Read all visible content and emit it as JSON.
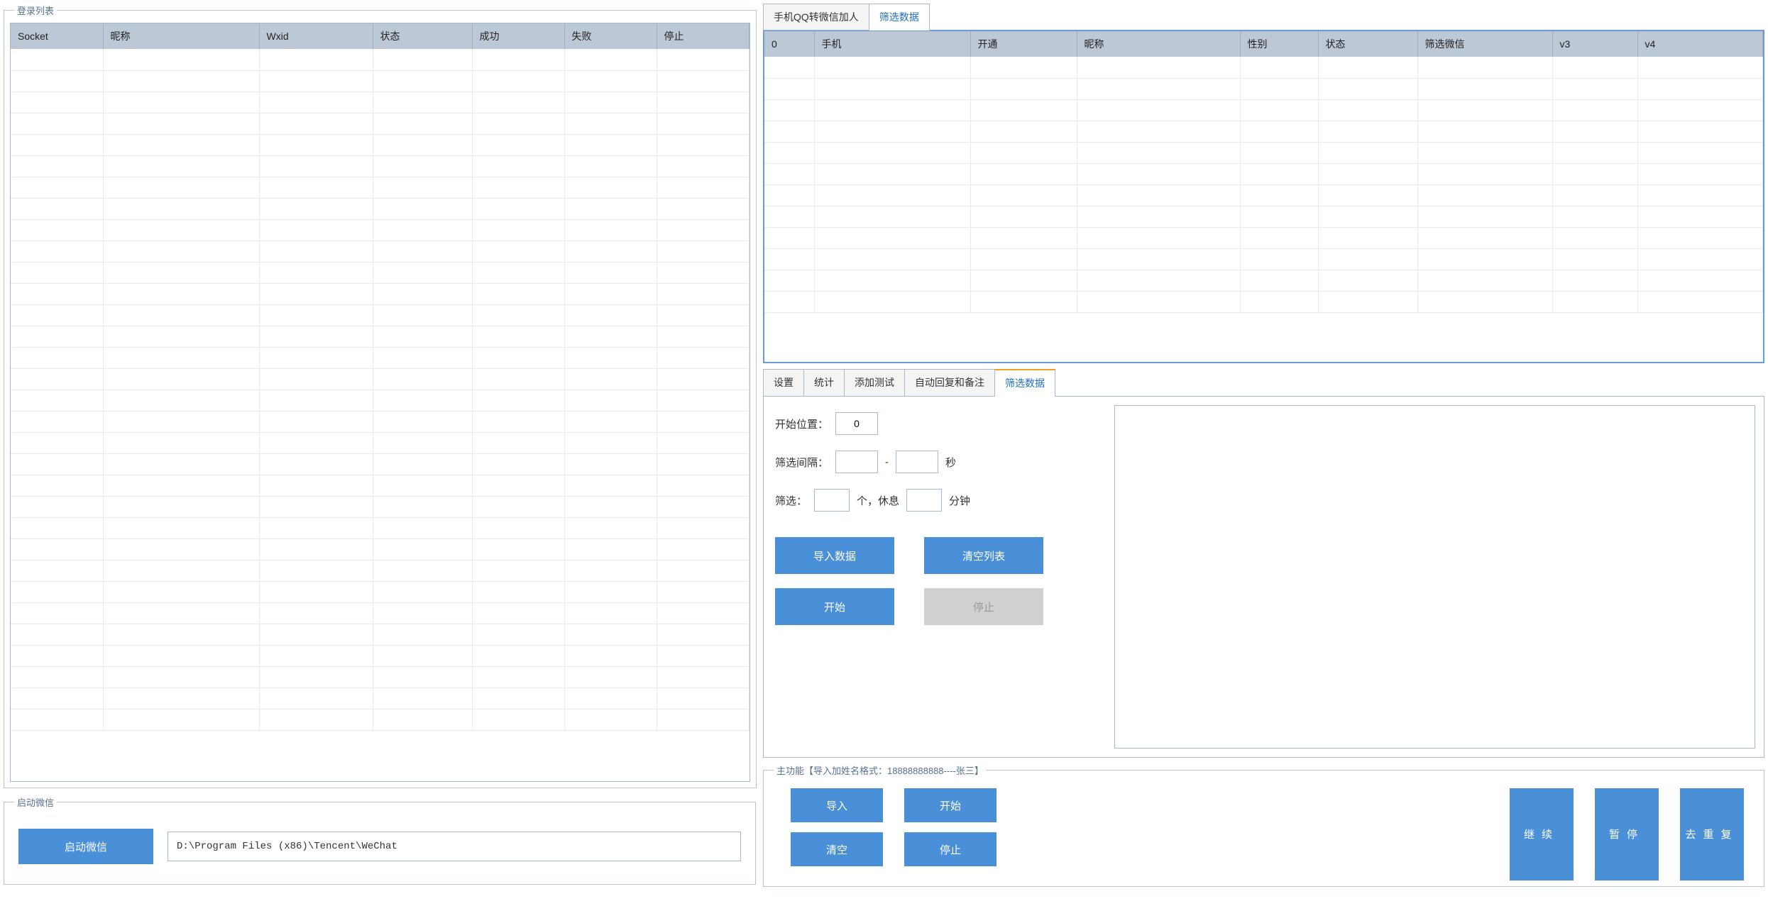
{
  "login_list": {
    "title": "登录列表",
    "headers": [
      "Socket",
      "昵称",
      "Wxid",
      "状态",
      "成功",
      "失败",
      "停止"
    ]
  },
  "launch_wechat": {
    "title": "启动微信",
    "button_label": "启动微信",
    "path": "D:\\Program Files (x86)\\Tencent\\WeChat"
  },
  "top_tabs": {
    "tab1": "手机QQ转微信加人",
    "tab2": "筛选数据"
  },
  "data_table": {
    "headers": [
      "0",
      "手机",
      "开通",
      "昵称",
      "性别",
      "状态",
      "筛选微信",
      "v3",
      "v4"
    ]
  },
  "mid_tabs": {
    "tab1": "设置",
    "tab2": "统计",
    "tab3": "添加测试",
    "tab4": "自动回复和备注",
    "tab5": "筛选数据"
  },
  "filter_form": {
    "start_pos_label": "开始位置：",
    "start_pos_value": "0",
    "interval_label": "筛选间隔：",
    "dash": "-",
    "seconds": "秒",
    "filter_label": "筛选：",
    "count_suffix": "个，休息",
    "minutes": "分钟",
    "import_btn": "导入数据",
    "clear_btn": "清空列表",
    "start_btn": "开始",
    "stop_btn": "停止"
  },
  "main_actions": {
    "title": "主功能【导入加姓名格式：18888888888----张三】",
    "import": "导入",
    "start": "开始",
    "clear": "清空",
    "stop": "停止",
    "continue": "继续",
    "pause": "暂停",
    "dedup": "去重复"
  }
}
